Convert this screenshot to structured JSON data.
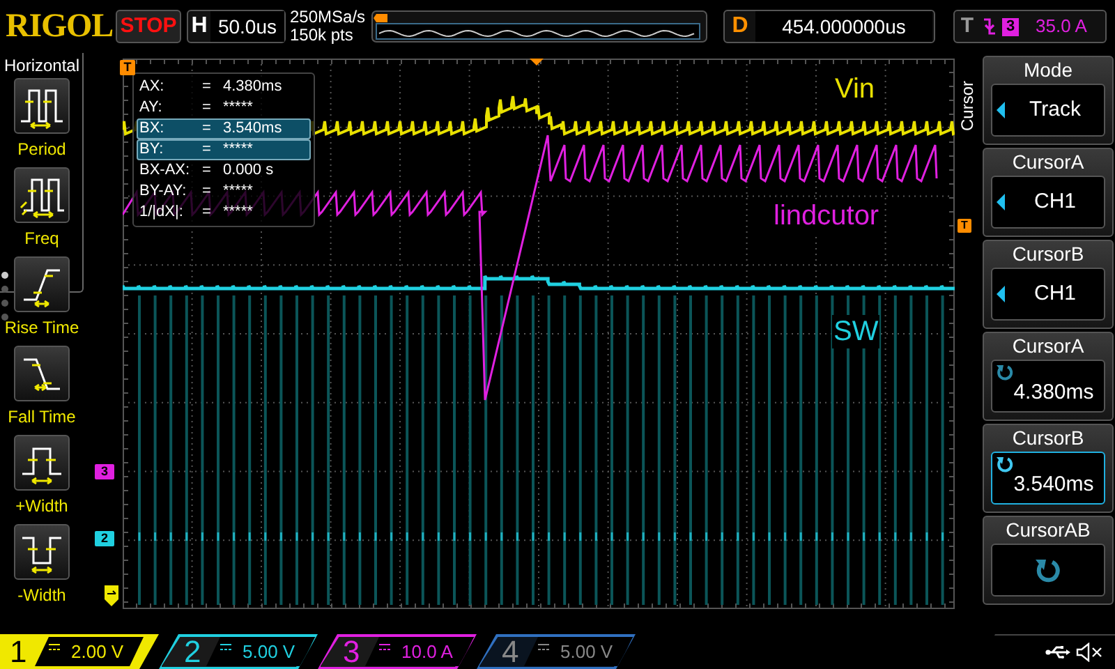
{
  "brand": "RIGOL",
  "run_state": "STOP",
  "timebase": {
    "label": "H",
    "value": "50.0us"
  },
  "sampling": {
    "rate": "250MSa/s",
    "depth": "150k pts"
  },
  "delay": {
    "label": "D",
    "value": "454.000000us"
  },
  "trigger": {
    "label": "T",
    "source": "3",
    "level": "35.0 A"
  },
  "left_menu": {
    "title": "Horizontal",
    "items": [
      {
        "label": "Period",
        "kind": "period"
      },
      {
        "label": "Freq",
        "kind": "freq"
      },
      {
        "label": "Rise Time",
        "kind": "rise"
      },
      {
        "label": "Fall Time",
        "kind": "fall"
      },
      {
        "label": "+Width",
        "kind": "pwidth"
      },
      {
        "label": "-Width",
        "kind": "nwidth"
      }
    ]
  },
  "cursor_readout": [
    {
      "label": "AX:",
      "sign": "=",
      "value": "4.380ms",
      "selected": false
    },
    {
      "label": "AY:",
      "sign": "=",
      "value": "*****",
      "selected": false
    },
    {
      "label": "BX:",
      "sign": "=",
      "value": "3.540ms",
      "selected": true
    },
    {
      "label": "BY:",
      "sign": "=",
      "value": "*****",
      "selected": true
    },
    {
      "label": "BX-AX:",
      "sign": "=",
      "value": "0.000 s",
      "selected": false
    },
    {
      "label": "BY-AY:",
      "sign": "=",
      "value": "*****",
      "selected": false
    },
    {
      "label": "1/|dX|:",
      "sign": "=",
      "value": "*****",
      "selected": false
    }
  ],
  "trace_labels": [
    {
      "text": "Vin",
      "color": "#e8e000"
    },
    {
      "text": "lindcutor",
      "color": "#e020e0"
    },
    {
      "text": "SW",
      "color": "#20d0e0"
    }
  ],
  "markers": [
    {
      "text": "T",
      "color": "#ff8c00"
    },
    {
      "text": "3",
      "color": "#e020e0"
    },
    {
      "text": "2",
      "color": "#20d0e0"
    },
    {
      "text": "T",
      "color": "#ff8c00"
    }
  ],
  "right_menu": {
    "title": "Cursor",
    "items": [
      {
        "title": "Mode",
        "value": "Track",
        "kind": "select",
        "selected": false
      },
      {
        "title": "CursorA",
        "value": "CH1",
        "kind": "select",
        "selected": false
      },
      {
        "title": "CursorB",
        "value": "CH1",
        "kind": "select",
        "selected": false
      },
      {
        "title": "CursorA",
        "value": "4.380ms",
        "kind": "knob",
        "selected": false
      },
      {
        "title": "CursorB",
        "value": "3.540ms",
        "kind": "knob",
        "selected": true
      },
      {
        "title": "CursorAB",
        "kind": "knob",
        "selected": false
      }
    ]
  },
  "channels": [
    {
      "number": "1",
      "scale": "2.00 V",
      "color": "#f0e800",
      "on": true,
      "selected": true
    },
    {
      "number": "2",
      "scale": "5.00 V",
      "color": "#20d0e0",
      "on": true,
      "selected": false
    },
    {
      "number": "3",
      "scale": "10.0 A",
      "color": "#e020e0",
      "on": true,
      "selected": false
    },
    {
      "number": "4",
      "scale": "5.00 V",
      "color": "#3070c0",
      "on": false,
      "selected": false
    }
  ]
}
